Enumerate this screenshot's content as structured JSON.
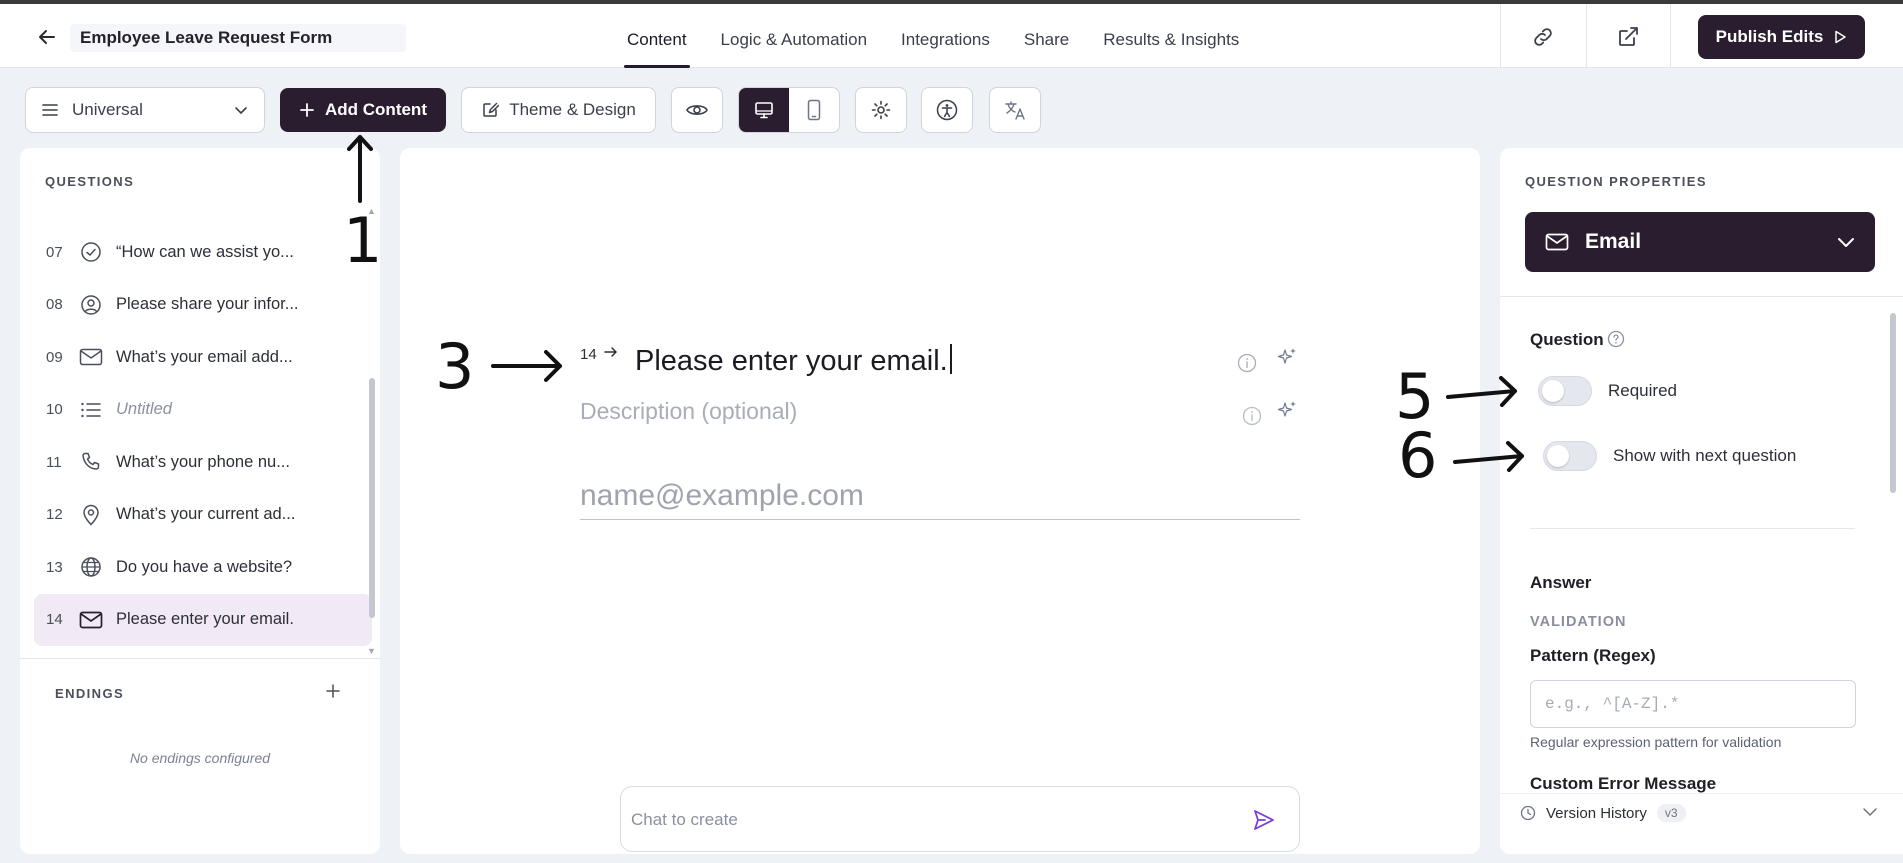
{
  "header": {
    "form_title": "Employee Leave Request Form",
    "tabs": [
      {
        "label": "Content",
        "active": true
      },
      {
        "label": "Logic & Automation",
        "active": false
      },
      {
        "label": "Integrations",
        "active": false
      },
      {
        "label": "Share",
        "active": false
      },
      {
        "label": "Results & Insights",
        "active": false
      }
    ],
    "publish_label": "Publish Edits"
  },
  "toolbar": {
    "language_select": "Universal",
    "add_content_label": "Add Content",
    "theme_label": "Theme & Design"
  },
  "left_panel": {
    "questions_label": "QUESTIONS",
    "questions": [
      {
        "num": "07",
        "icon": "check-circle-icon",
        "text": "“How can we assist yo..."
      },
      {
        "num": "08",
        "icon": "user-circle-icon",
        "text": "Please share your infor..."
      },
      {
        "num": "09",
        "icon": "mail-icon",
        "text": "What’s your email add..."
      },
      {
        "num": "10",
        "icon": "list-icon",
        "text": "Untitled"
      },
      {
        "num": "11",
        "icon": "phone-icon",
        "text": "What’s your phone nu..."
      },
      {
        "num": "12",
        "icon": "map-pin-icon",
        "text": "What’s your current ad..."
      },
      {
        "num": "13",
        "icon": "globe-icon",
        "text": "Do you have a website?"
      },
      {
        "num": "14",
        "icon": "mail-icon",
        "text": "Please enter your email."
      }
    ],
    "endings_label": "ENDINGS",
    "no_endings": "No endings configured"
  },
  "canvas": {
    "question_number": "14",
    "question_title": "Please enter your email.",
    "description_placeholder": "Description (optional)",
    "email_placeholder": "name@example.com",
    "chat_placeholder": "Chat to create"
  },
  "right_panel": {
    "properties_label": "QUESTION PROPERTIES",
    "question_type": "Email",
    "question_heading": "Question",
    "required_label": "Required",
    "show_next_label": "Show with next question",
    "answer_heading": "Answer",
    "validation_label": "VALIDATION",
    "pattern_label": "Pattern (Regex)",
    "pattern_placeholder": "e.g., ^[A-Z].*",
    "pattern_hint": "Regular expression pattern for validation",
    "custom_error_label": "Custom Error Message",
    "version_history": "Version History",
    "version_badge": "v3"
  },
  "annotations": {
    "a1": "1",
    "a3": "3",
    "a5": "5",
    "a6": "6"
  },
  "colors": {
    "accent_dark": "#2b1d30",
    "active_item_bg": "#f1e9f3",
    "send_icon": "#7a3fd6"
  }
}
